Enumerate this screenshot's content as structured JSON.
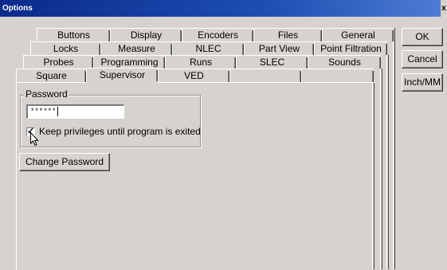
{
  "window": {
    "title": "Options",
    "close_label": "x"
  },
  "tabs": {
    "row1": [
      "Buttons",
      "Display",
      "Encoders",
      "Files",
      "General"
    ],
    "row2": [
      "Locks",
      "Measure",
      "NLEC",
      "Part View",
      "Point Filtration"
    ],
    "row3": [
      "Probes",
      "Programming",
      "Runs",
      "SLEC",
      "Sounds"
    ],
    "row4": [
      "Square",
      "Supervisor",
      "VED"
    ],
    "active": "Supervisor"
  },
  "password_group": {
    "label": "Password",
    "value": "******",
    "keep_privileges_label": "Keep privileges until program is exited",
    "keep_privileges_checked": true
  },
  "buttons": {
    "change_password": "Change Password",
    "ok": "OK",
    "cancel": "Cancel",
    "inch_mm": "Inch/MM"
  }
}
